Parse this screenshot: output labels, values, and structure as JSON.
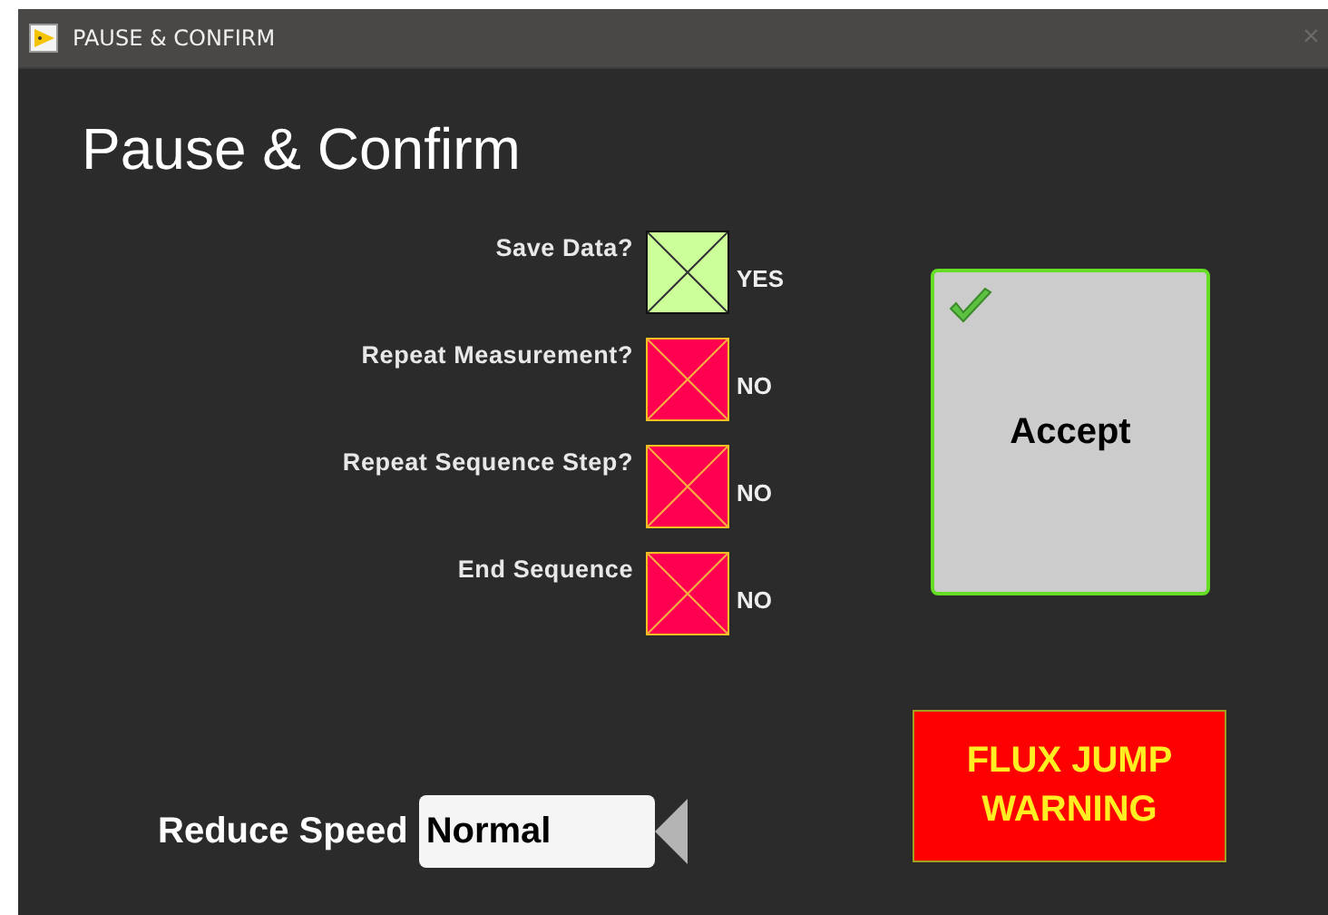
{
  "window": {
    "title": "PAUSE & CONFIRM",
    "close": "×"
  },
  "heading": "Pause & Confirm",
  "options": [
    {
      "label": "Save Data?",
      "checked": true,
      "state": "YES"
    },
    {
      "label": "Repeat Measurement?",
      "checked": false,
      "state": "NO"
    },
    {
      "label": "Repeat Sequence Step?",
      "checked": false,
      "state": "NO"
    },
    {
      "label": "End Sequence",
      "checked": false,
      "state": "NO"
    }
  ],
  "accept_button": {
    "label": "Accept"
  },
  "warning": {
    "text": "FLUX JUMP WARNING",
    "on": true
  },
  "speed": {
    "label": "Reduce Speed",
    "value": "Normal"
  }
}
